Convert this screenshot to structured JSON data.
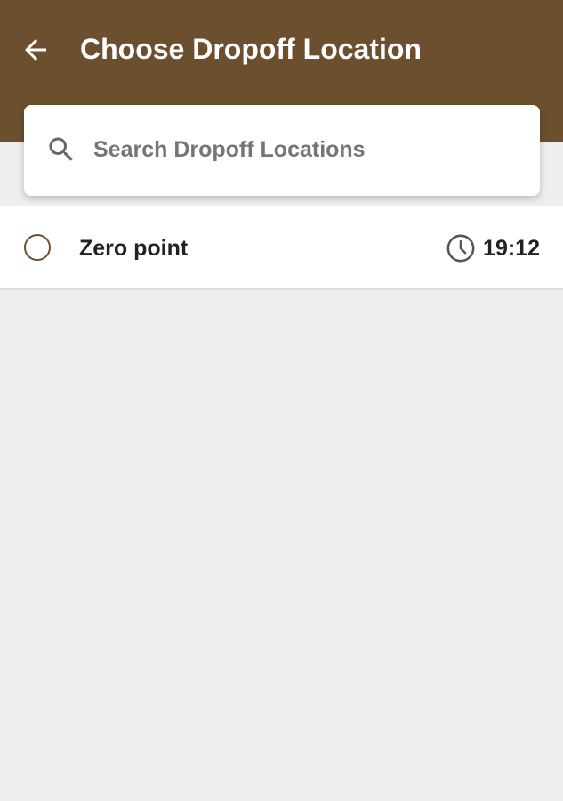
{
  "header": {
    "title": "Choose Dropoff Location",
    "back_icon": "arrow-left-icon",
    "background_color": "#6b4f2e"
  },
  "search": {
    "placeholder": "Search Dropoff Locations",
    "value": "",
    "icon": "search-icon"
  },
  "locations": [
    {
      "name": "Zero point",
      "time": "19:12",
      "selected": false,
      "time_icon": "clock-icon"
    }
  ],
  "colors": {
    "accent": "#6b4f2e",
    "page_background": "#eeeeee"
  }
}
